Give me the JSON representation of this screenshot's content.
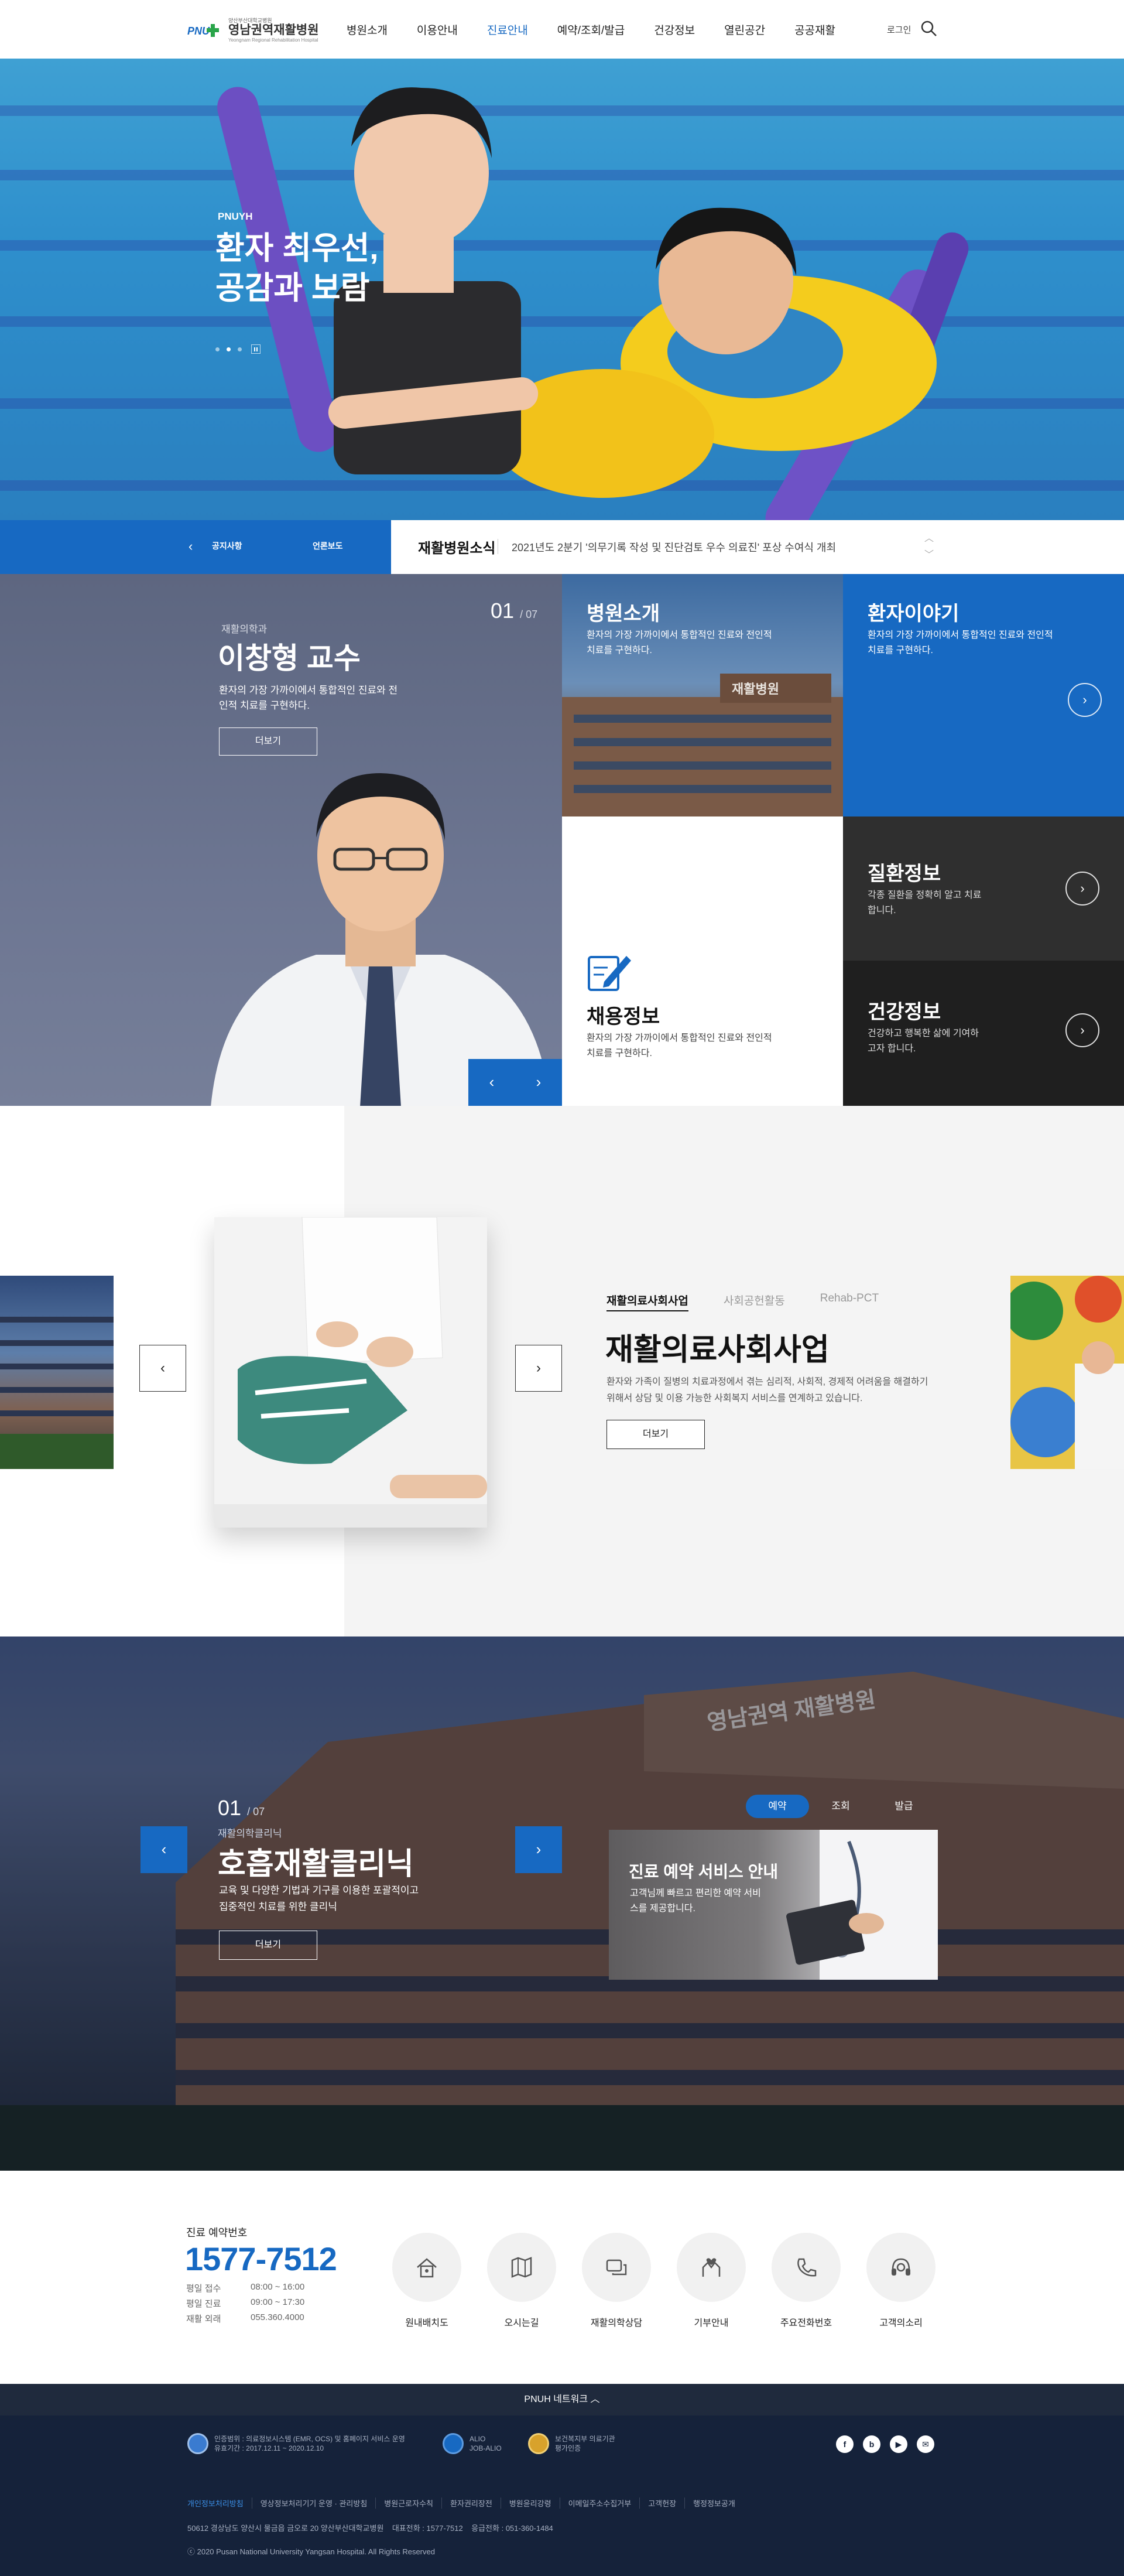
{
  "header": {
    "logo": {
      "small_text": "양산부산대학교병원",
      "name": "영남권역재활병원",
      "sub": "Yeongnam Regional Rehabilitation Hospital",
      "mark_text": "PNU"
    },
    "nav": [
      "병원소개",
      "이용안내",
      "진료안내",
      "예약/조회/발급",
      "건강정보",
      "열린공간",
      "공공재활"
    ],
    "active_nav": "진료안내",
    "login": "로그인",
    "search_icon": "search-icon"
  },
  "hero": {
    "subtitle": "PNUYH",
    "title": "환자 최우선,\n공감과 보람",
    "slides": 3,
    "active_slide": 2
  },
  "notice": {
    "tab1": "공지사항",
    "tab2": "언론보도",
    "label": "재활병원소식",
    "text": "2021년도 2분기 '의무기록 작성 및 진단검토 우수 의료진' 포상 수여식 개최"
  },
  "doctor": {
    "counter_current": "01",
    "counter_total": "/ 07",
    "dept": "재활의학과",
    "name": "이창형 교수",
    "desc": "환자의 가장 가까이에서 통합적인 진료와 전인적 치료를 구현하다.",
    "more": "더보기",
    "prev": "‹",
    "next": "›"
  },
  "tiles": {
    "hospital": {
      "title": "병원소개",
      "desc": "환자의 가장 가까이에서 통합적인 진료와 전인적 치료를 구현하다."
    },
    "story": {
      "title": "환자이야기",
      "desc": "환자의 가장 가까이에서 통합적인 진료와 전인적 치료를 구현하다."
    },
    "recruit": {
      "title": "채용정보",
      "desc": "환자의 가장 가까이에서 통합적인 진료와 전인적 치료를 구현하다."
    },
    "disease": {
      "title": "질환정보",
      "desc": "각종 질환을 정확히 알고 치료합니다."
    },
    "health": {
      "title": "건강정보",
      "desc": "건강하고 행복한 삶에 기여하고자 합니다."
    },
    "building_sign": "재활병원"
  },
  "business": {
    "tabs": [
      "재활의료사회사업",
      "사회공헌활동",
      "Rehab-PCT"
    ],
    "active_tab": "재활의료사회사업",
    "title": "재활의료사회사업",
    "desc": "환자와 가족이 질병의 치료과정에서 겪는 심리적, 사회적, 경제적 어려움을 해결하기 위해서 상담 및 이용 가능한 사회복지 서비스를 연계하고 있습니다.",
    "more": "더보기",
    "prev": "‹",
    "next": "›"
  },
  "clinic": {
    "counter_current": "01",
    "counter_total": "/ 07",
    "category": "재활의학클리닉",
    "title": "호흡재활클리닉",
    "desc": "교육 및 다양한 기법과 기구를 이용한 포괄적이고 집중적인 치료를 위한 클리닉",
    "more": "더보기",
    "building_sign": "영남권역 재활병원",
    "prev": "‹",
    "next": "›",
    "reserve_tabs": [
      "예약",
      "조회",
      "발급"
    ],
    "active_reserve_tab": "예약",
    "card_title": "진료 예약 서비스 안내",
    "card_desc": "고객님께 빠르고 편리한 예약 서비스를 제공합니다."
  },
  "contact": {
    "label": "진료 예약번호",
    "phone": "1577-7512",
    "hours": [
      {
        "k": "평일 접수",
        "v": "08:00 ~ 16:00"
      },
      {
        "k": "평일 진료",
        "v": "09:00 ~ 17:30"
      },
      {
        "k": "재활 외래",
        "v": "055.360.4000"
      }
    ],
    "quick": [
      {
        "label": "원내배치도",
        "icon": "building-map-icon"
      },
      {
        "label": "오시는길",
        "icon": "map-route-icon"
      },
      {
        "label": "재활의학상담",
        "icon": "chat-bubble-icon"
      },
      {
        "label": "기부안내",
        "icon": "donation-hands-icon"
      },
      {
        "label": "주요전화번호",
        "icon": "phone-book-icon"
      },
      {
        "label": "고객의소리",
        "icon": "headset-icon"
      }
    ]
  },
  "footer": {
    "network": "PNUH 네트워크",
    "badges": [
      {
        "text1": "인증범위 : 의료정보시스템 (EMR, OCS) 및 홈페이지 서비스 운영",
        "text2": "유효기간 : 2017.12.11 ~ 2020.12.10"
      },
      {
        "text1": "ALIO",
        "text2": "JOB-ALIO"
      },
      {
        "text1": "보건복지부 의료기관",
        "text2": "평가인증"
      }
    ],
    "social": [
      "f",
      "b",
      "▶",
      "✉"
    ],
    "links": [
      "개인정보처리방침",
      "영상정보처리기기 운영 · 관리방침",
      "병원근로자수칙",
      "환자권리장전",
      "병원윤리강령",
      "이메일주소수집거부",
      "고객헌장",
      "행정정보공개"
    ],
    "address": "50612 경상남도 양산시 물금읍 금오로 20 양산부산대학교병원    대표전화 : 1577-7512    응급전화 : 051-360-1484",
    "copyright": "ⓒ 2020 Pusan National University Yangsan Hospital. All Rights Reserved"
  },
  "colors": {
    "brand_blue": "#1769c2",
    "dark_tile": "#2f2f2f",
    "darker_tile": "#1f1f1f",
    "footer": "#15223a",
    "logo_green": "#2aa54a"
  }
}
